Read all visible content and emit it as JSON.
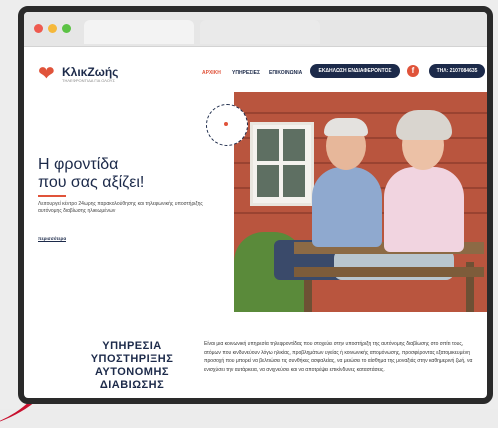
{
  "brand": {
    "name": "ΚλικΖωής",
    "tagline": "ΤΗΛΕΦΡΟΝΤΙΔΑ ΓΙΑ ΟΛΟΥΣ",
    "accent": "#e0533a",
    "navy": "#1c2a4a"
  },
  "nav": {
    "items": [
      {
        "label": "ΑΡΧΙΚΗ",
        "active": true
      },
      {
        "label": "ΥΠΗΡΕΣΙΕΣ",
        "active": false
      },
      {
        "label": "ΕΠΙΚΟΙΝΩΝΙΑ",
        "active": false
      }
    ],
    "cta_label": "ΕΚΔΗΛΩΣΗ ΕΝΔΙΑΦΕΡΟΝΤΟΣ",
    "facebook_glyph": "f",
    "facebook_icon": "facebook-icon",
    "phone_label": "ΤΗΛ: 2107084635"
  },
  "hero": {
    "title_line1": "Η φροντίδα",
    "title_line2": "που σας αξίζει!",
    "description": "Λειτουργεί κέντρο 24ωρης παρακολούθησης και τηλεφωνικής υποστήριξης αυτόνομης διαβίωσης ηλικιωμένων",
    "link_label": "περισσότερα"
  },
  "service": {
    "title_line1": "ΥΠΗΡΕΣΙΑ",
    "title_line2": "ΥΠΟΣΤΗΡΙΞΗΣ",
    "title_line3": "ΑΥΤΟΝΟΜΗΣ",
    "title_line4": "ΔΙΑΒΙΩΣΗΣ",
    "text": "Είναι μια κοινωνική υπηρεσία τηλεφροντίδας που στοχεύει στην υποστήριξη της αυτόνομης διαβίωσης στο σπίτι τους, ατόμων που κινδυνεύουν λόγω ηλικίας, προβλημάτων υγείας ή κοινωνικής απομόνωσης, προσφέροντας εξατομικευμένη προσοχή που μπορεί να βελτιώσει τις συνθήκες ασφαλείας, να μειώσει το αίσθημα της μοναξιάς στην καθημερινή ζωή, να ενισχύσει την αυτάρκεια, να ανιχνεύσει και να αποτρέψει επικίνδυνες καταστάσεις."
  },
  "browser": {
    "buttons": [
      "close",
      "minimize",
      "maximize"
    ]
  }
}
